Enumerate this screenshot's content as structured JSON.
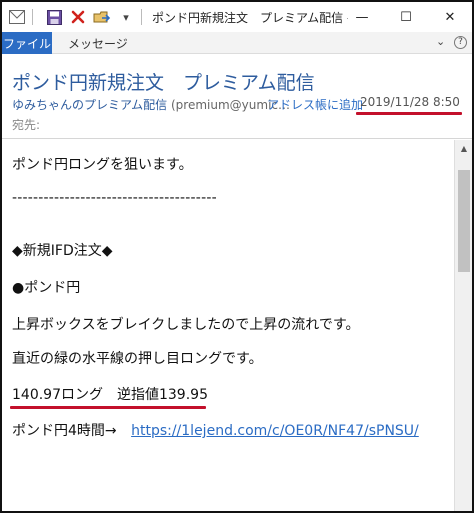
{
  "window": {
    "title": "ポンド円新規注文　プレミアム配信 - ...",
    "minimize": "—",
    "maximize": "☐",
    "close": "✕",
    "qa_dropdown": "▾"
  },
  "ribbon": {
    "tabs": [
      {
        "label": "ファイル",
        "active": true
      },
      {
        "label": "メッセージ",
        "active": false
      }
    ],
    "collapse_chevron": "⌄",
    "help": "?"
  },
  "header": {
    "subject": "ポンド円新規注文　プレミアム配信",
    "sender_name": "ゆみちゃんのプレミアム配信",
    "sender_email": "(premium@yumic…",
    "add_to_address_book": "アドレス帳に追加",
    "datetime": "2019/11/28 8:50",
    "to_label": "宛先:"
  },
  "body": {
    "lines": [
      "ポンド円ロングを狙います。",
      "---------------------------------------",
      "◆新規IFD注文◆",
      "●ポンド円",
      "上昇ボックスをブレイクしましたので上昇の流れです。",
      "直近の緑の水平線の押し目ロングです。",
      "140.97ロング　逆指値139.95"
    ],
    "chart_link_label": "ポンド円4時間→",
    "chart_link_url": "https://1lejend.com/c/OE0R/NF47/sPNSU/"
  },
  "colors": {
    "accent": "#2b6cc4",
    "subject": "#2e5c9e",
    "highlight_underline": "#c3102b"
  }
}
